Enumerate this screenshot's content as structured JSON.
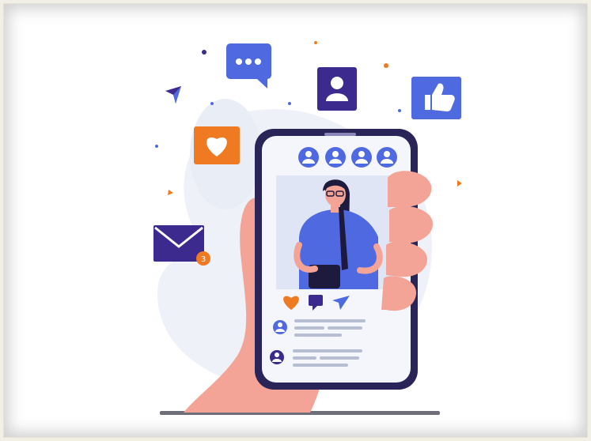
{
  "colors": {
    "accent_blue": "#4f6ae0",
    "accent_purple": "#3d2a8f",
    "accent_orange": "#f07a22",
    "hand_pink": "#f3a497",
    "blob_grey": "#eef1f7",
    "phone_dark": "#2a2558"
  },
  "icons": {
    "chat": "chat-bubble-icon",
    "profile": "profile-card-icon",
    "like": "thumbs-up-icon",
    "heart": "heart-icon",
    "mail": "envelope-icon",
    "send": "paper-plane-icon"
  },
  "mail_badge_count": "3"
}
